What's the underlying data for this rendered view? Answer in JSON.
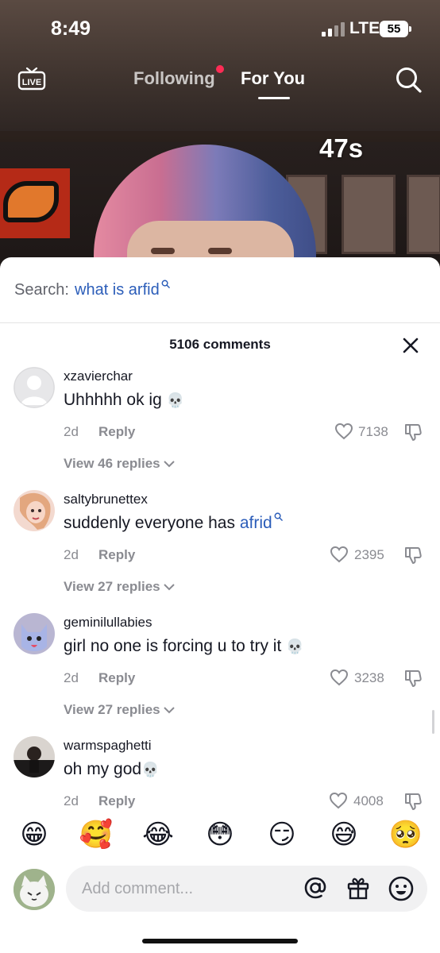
{
  "status_bar": {
    "time": "8:49",
    "network": "LTE",
    "battery": "55"
  },
  "top_nav": {
    "live_label": "LIVE",
    "following_label": "Following",
    "for_you_label": "For You"
  },
  "video": {
    "duration_badge": "47s"
  },
  "comments_sheet": {
    "search_prefix": "Search:",
    "search_query": "what is arfid",
    "count_label": "5106 comments",
    "comments": [
      {
        "username": "xzavierchar",
        "text": "Uhhhhh ok ig",
        "emoji": "💀",
        "age": "2d",
        "reply_label": "Reply",
        "likes": "7138",
        "view_replies": "View 46 replies"
      },
      {
        "username": "saltybrunettex",
        "text": "suddenly everyone has",
        "link_text": "afrid",
        "age": "2d",
        "reply_label": "Reply",
        "likes": "2395",
        "view_replies": "View 27 replies"
      },
      {
        "username": "geminilullabies",
        "text": "girl no one is forcing u to try it",
        "emoji": "💀",
        "age": "2d",
        "reply_label": "Reply",
        "likes": "3238",
        "view_replies": "View 27 replies"
      },
      {
        "username": "warmspaghetti",
        "text": "oh my god",
        "emoji": "💀",
        "age": "2d",
        "reply_label": "Reply",
        "likes": "4008"
      }
    ]
  },
  "quick_emojis": [
    "😁",
    "🥰",
    "😂",
    "😳",
    "😏",
    "😅",
    "🥺"
  ],
  "composer": {
    "placeholder": "Add comment..."
  },
  "icons": {
    "live": "live-tv-icon",
    "search": "search-icon",
    "close": "close-icon",
    "heart": "heart-outline-icon",
    "dislike": "thumbs-down-icon",
    "chevron": "chevron-down-icon",
    "mention": "at-icon",
    "gift": "gift-icon",
    "emoji": "smiley-icon"
  },
  "colors": {
    "accent_link": "#2b5db9",
    "notification_dot": "#fe2c55",
    "muted_text": "#8a8b91"
  }
}
